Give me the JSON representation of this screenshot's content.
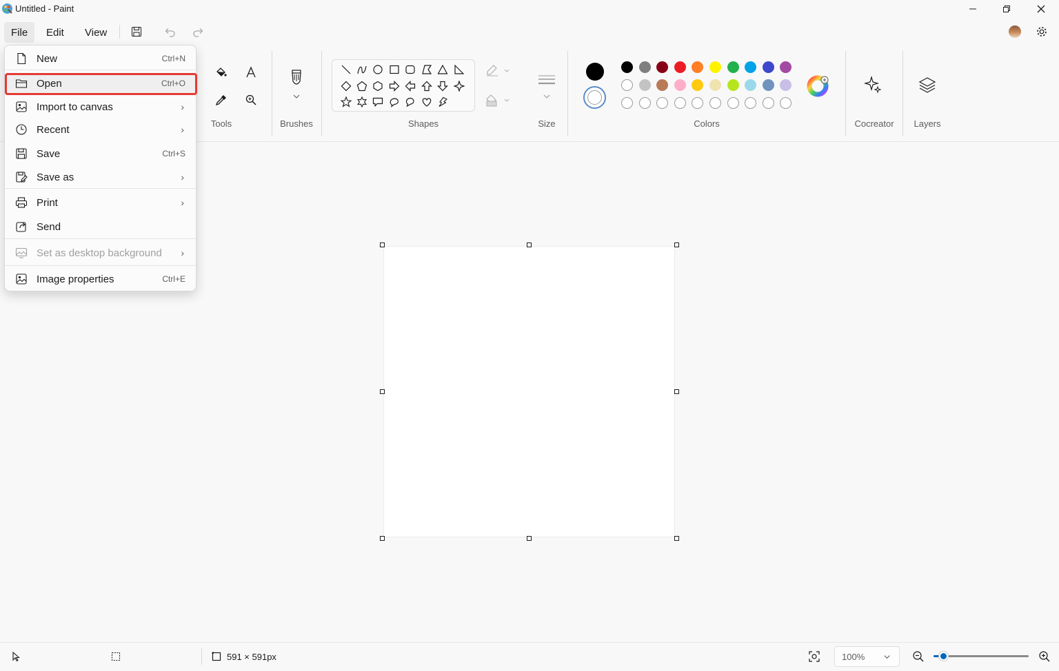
{
  "window": {
    "title": "Untitled - Paint"
  },
  "menubar": {
    "file": "File",
    "edit": "Edit",
    "view": "View"
  },
  "ribbon": {
    "tools_label": "Tools",
    "brushes_label": "Brushes",
    "shapes_label": "Shapes",
    "size_label": "Size",
    "colors_label": "Colors",
    "cocreator_label": "Cocreator",
    "layers_label": "Layers",
    "primary_color": "#000000",
    "secondary_color": "#ffffff",
    "palette_row1": [
      "#000000",
      "#7f7f7f",
      "#880015",
      "#ed1c24",
      "#ff7f27",
      "#fff200",
      "#22b14c",
      "#00a2e8",
      "#3f48cc",
      "#a349a4"
    ],
    "palette_row2": [
      "#ffffff",
      "#c3c3c3",
      "#b97a57",
      "#ffaec9",
      "#ffc90e",
      "#efe4b0",
      "#b5e61d",
      "#99d9ea",
      "#7092be",
      "#c8bfe7"
    ],
    "palette_row3_custom_slots": 10
  },
  "file_menu": {
    "items": [
      {
        "label": "New",
        "shortcut": "Ctrl+N",
        "icon": "new-file-icon"
      },
      {
        "label": "Open",
        "shortcut": "Ctrl+O",
        "icon": "open-folder-icon"
      },
      {
        "label": "Import to canvas",
        "shortcut": "",
        "icon": "import-image-icon"
      },
      {
        "label": "Recent",
        "shortcut": "",
        "icon": "clock-icon"
      },
      {
        "label": "Save",
        "shortcut": "Ctrl+S",
        "icon": "save-icon"
      },
      {
        "label": "Save as",
        "shortcut": "",
        "icon": "save-as-icon"
      },
      {
        "label": "Print",
        "shortcut": "",
        "icon": "printer-icon"
      },
      {
        "label": "Send",
        "shortcut": "",
        "icon": "share-icon"
      },
      {
        "label": "Set as desktop background",
        "shortcut": "",
        "icon": "desktop-background-icon"
      },
      {
        "label": "Image properties",
        "shortcut": "Ctrl+E",
        "icon": "image-properties-icon"
      }
    ],
    "chevron": "›"
  },
  "statusbar": {
    "canvas_size": "591 × 591px",
    "zoom": "100%",
    "zoom_fraction": 0.1
  }
}
